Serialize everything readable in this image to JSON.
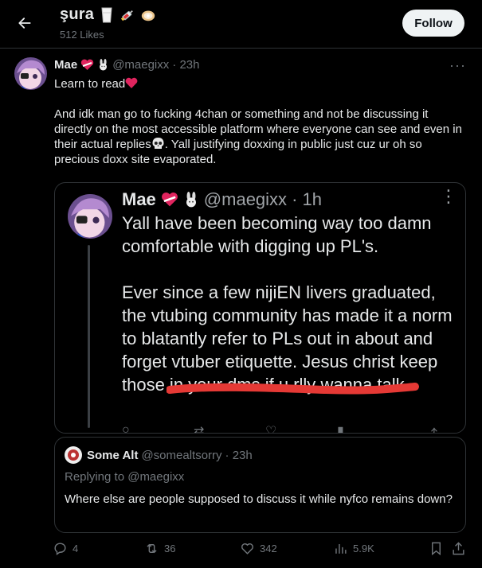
{
  "header": {
    "back_icon": "arrow-left-icon",
    "title": "şura",
    "title_emojis": [
      "milk-glass-icon",
      "syringe-icon",
      "oyster-icon"
    ],
    "subtitle": "512 Likes",
    "follow_label": "Follow"
  },
  "post": {
    "name": "Mae",
    "name_emojis": [
      "heart-ribbon-icon",
      "rabbit-icon"
    ],
    "handle": "@maegixx",
    "time": "· 23h",
    "more": "···",
    "line1": "Learn to read",
    "line1_emoji": "red-heart-icon",
    "para2_a": "And idk man go to fucking 4chan or something and not be discussing it directly on the most accessible platform where everyone can see and even in their actual replies",
    "para2_emoji": "skull-icon",
    "para2_b": ". Yall justifying doxxing in public just cuz ur oh so precious doxx site evaporated."
  },
  "quoted_screenshot": {
    "name": "Mae",
    "name_emojis": [
      "heart-ribbon-icon",
      "rabbit-icon"
    ],
    "handle": "@maegixx",
    "time": "· 1h",
    "more": "⋮",
    "para1": "Yall have been becoming way too damn comfortable with digging up PL's.",
    "para2_a": "Ever since a few nijiEN livers graduated, the vtubing community has made it a norm to blatantly refer to PLs out in about and forget vtuber etiquette. Jesus christ",
    "para2_highlight": "keep those in your dms if u rlly",
    "para2_b": "wanna talk"
  },
  "reply": {
    "name": "Some Alt",
    "handle": "@somealtsorry",
    "time": "· 23h",
    "replying_to": "Replying to @maegixx",
    "text": "Where else are people supposed to discuss it while nyfco remains down?"
  },
  "actions": {
    "replies": "4",
    "retweets": "36",
    "likes": "342",
    "views": "5.9K"
  },
  "colors": {
    "background": "#000000",
    "text": "#e7e9ea",
    "muted": "#71767b",
    "border": "#2f3336",
    "underline_red": "#e53935"
  }
}
